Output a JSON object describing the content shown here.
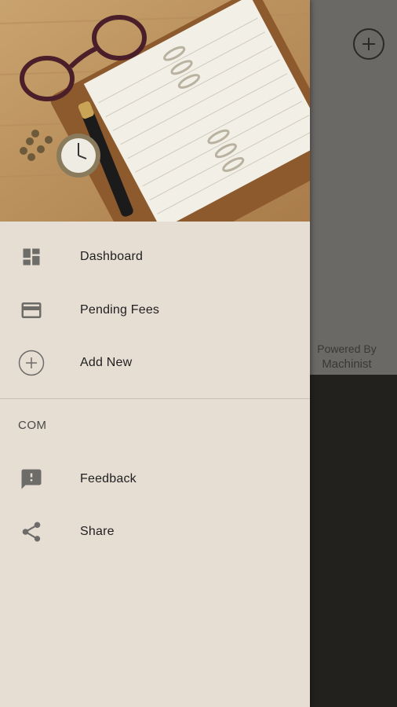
{
  "background": {
    "powered_by": "Powered By",
    "brand": "Machinist",
    "add_icon": "plus-circle-icon"
  },
  "drawer": {
    "header_image": "notebook-glasses-pocketwatch-photo",
    "items": [
      {
        "label": "Dashboard",
        "icon": "dashboard-icon"
      },
      {
        "label": "Pending Fees",
        "icon": "credit-card-icon"
      },
      {
        "label": "Add New",
        "icon": "add-circle-icon"
      }
    ],
    "section_title": "COM",
    "section_items": [
      {
        "label": "Feedback",
        "icon": "feedback-icon"
      },
      {
        "label": "Share",
        "icon": "share-icon"
      }
    ]
  }
}
